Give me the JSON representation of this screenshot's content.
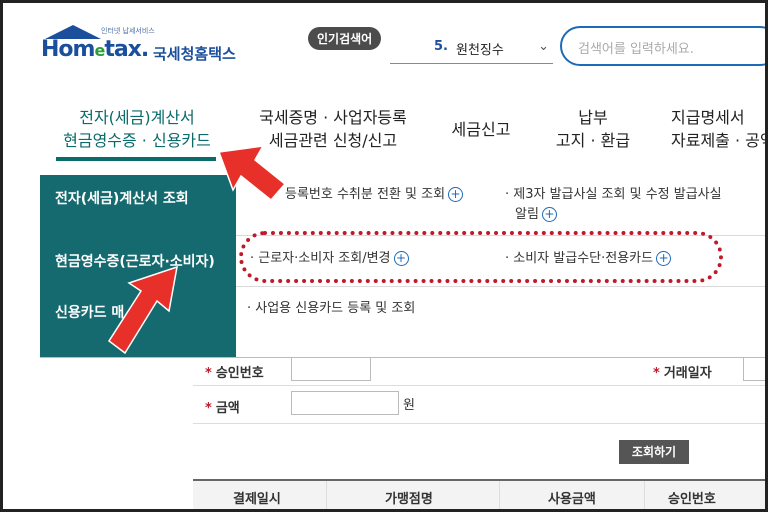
{
  "header": {
    "logo_tagline": "인터넷 납세서비스",
    "logo_wordmark_prefix": "Hom",
    "logo_wordmark_e": "e",
    "logo_wordmark_suffix": "tax.",
    "logo_korean": "국세청홈택스",
    "popular_label": "인기검색어",
    "popular_rank": "5.",
    "popular_term": "원천징수",
    "search_placeholder": "검색어를 입력하세요."
  },
  "nav": {
    "items": [
      {
        "line1": "전자(세금)계산서",
        "line2": "현금영수증 · 신용카드"
      },
      {
        "line1": "국세증명 · 사업자등록",
        "line2": "세금관련 신청/신고"
      },
      {
        "line1": "세금신고",
        "line2": ""
      },
      {
        "line1": "납부",
        "line2": "고지 · 환급"
      },
      {
        "line1": "지급명세서",
        "line2": "자료제출 · 공익"
      }
    ]
  },
  "dropdown": {
    "categories": [
      {
        "label": "전자(세금)계산서 조회"
      },
      {
        "label": "현금영수증(근로자·소비자)"
      },
      {
        "label": "신용카드 매"
      }
    ],
    "row1": {
      "item1": "등록번호 수취분 전환 및 조회",
      "item2_line1": "· 제3자 발급사실 조회 및 수정 발급사실",
      "item2_line2": "알림"
    },
    "row2": {
      "item1": "· 근로자·소비자 조회/변경",
      "item2": "· 소비자 발급수단·전용카드"
    },
    "row3": {
      "item1": "· 사업용 신용카드 등록 및 조회"
    },
    "plus_symbol": "+"
  },
  "form": {
    "approval_label": "승인번호",
    "trade_date_label": "거래일자",
    "amount_label": "금액",
    "amount_unit": "원",
    "required_mark": "*",
    "query_button": "조회하기",
    "table_headers": [
      "결제일시",
      "가맹점명",
      "사용금액",
      "승인번호"
    ]
  },
  "colors": {
    "brand_blue": "#1b4f9c",
    "teal_panel": "#156a6f",
    "highlight_red": "#e8302a",
    "dotted_outline": "#c0192b"
  }
}
